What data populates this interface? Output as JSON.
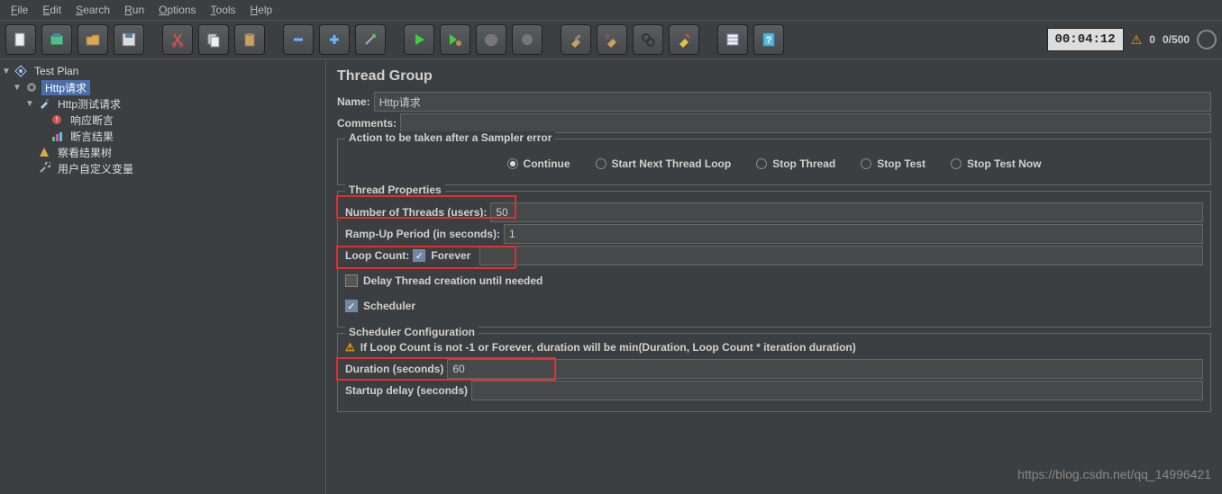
{
  "menu": {
    "file": "File",
    "edit": "Edit",
    "search": "Search",
    "run": "Run",
    "options": "Options",
    "tools": "Tools",
    "help": "Help"
  },
  "status": {
    "timer": "00:04:12",
    "warnings": "0",
    "threads": "0/500"
  },
  "tree": {
    "root": "Test Plan",
    "http": "Http请求",
    "httptest": "Http测试请求",
    "resp": "响应断言",
    "result": "断言结果",
    "view": "察看结果树",
    "uvar": "用户自定义变量"
  },
  "panel": {
    "title": "Thread Group",
    "nameLabel": "Name:",
    "nameValue": "Http请求",
    "commentsLabel": "Comments:",
    "actionLegend": "Action to be taken after a Sampler error",
    "optContinue": "Continue",
    "optNextLoop": "Start Next Thread Loop",
    "optStopThread": "Stop Thread",
    "optStopTest": "Stop Test",
    "optStopNow": "Stop Test Now",
    "tpLegend": "Thread Properties",
    "numThreadsLabel": "Number of Threads (users):",
    "numThreadsValue": "50",
    "rampLabel": "Ramp-Up Period (in seconds):",
    "rampValue": "1",
    "loopLabel": "Loop Count:",
    "foreverLabel": "Forever",
    "loopValue": "",
    "delayLabel": "Delay Thread creation until needed",
    "schedulerLabel": "Scheduler",
    "scLegend": "Scheduler Configuration",
    "scWarn": "If Loop Count is not -1 or Forever, duration will be min(Duration, Loop Count * iteration duration)",
    "durationLabel": "Duration (seconds)",
    "durationValue": "60",
    "startupLabel": "Startup delay (seconds)",
    "startupValue": ""
  },
  "watermark": "https://blog.csdn.net/qq_14996421"
}
